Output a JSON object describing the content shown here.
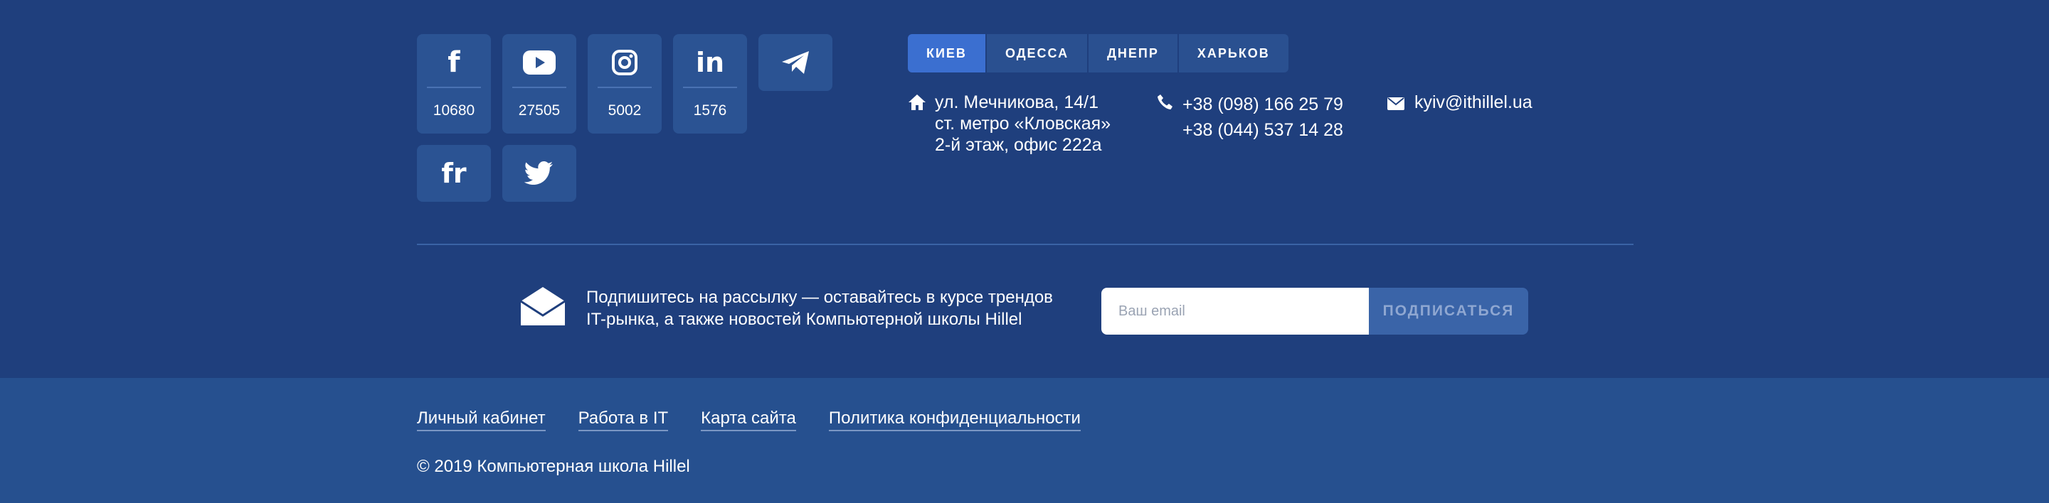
{
  "social": [
    {
      "network": "facebook",
      "icon": "facebook-icon",
      "glyph": "f",
      "count": "10680"
    },
    {
      "network": "youtube",
      "icon": "youtube-icon",
      "glyph": "",
      "count": "27505"
    },
    {
      "network": "instagram",
      "icon": "instagram-icon",
      "glyph": "",
      "count": "5002"
    },
    {
      "network": "linkedin",
      "icon": "linkedin-icon",
      "glyph": "in",
      "count": "1576"
    },
    {
      "network": "telegram",
      "icon": "telegram-icon",
      "glyph": ""
    },
    {
      "network": "fr",
      "icon": "fr-icon",
      "glyph": "fr"
    },
    {
      "network": "twitter",
      "icon": "twitter-icon",
      "glyph": ""
    }
  ],
  "city_tabs": [
    "КИЕВ",
    "ОДЕССА",
    "ДНЕПР",
    "ХАРЬКОВ"
  ],
  "active_city": "КИЕВ",
  "contacts": {
    "address": [
      "ул. Мечникова, 14/1",
      "ст. метро «Кловская»",
      "2-й этаж, офис 222а"
    ],
    "phones": [
      "+38 (098) 166 25 79",
      "+38 (044) 537 14 28"
    ],
    "email": "kyiv@ithillel.ua"
  },
  "subscribe": {
    "text_line1": "Подпишитесь на рассылку — оставайтесь в курсе трендов",
    "text_line2": "IT-рынка, а также новостей Компьютерной школы Hillel",
    "placeholder": "Ваш email",
    "button": "ПОДПИСАТЬСЯ"
  },
  "links": [
    "Личный кабинет",
    "Работа в IT",
    "Карта сайта",
    "Политика конфиденциальности"
  ],
  "copyright": "© 2019 Компьютерная школа Hillel",
  "colors": {
    "background": "#1f3f7d",
    "bottom_bar": "#26508f",
    "tile": "#2b5393",
    "active_tab": "#3b6fd0"
  }
}
